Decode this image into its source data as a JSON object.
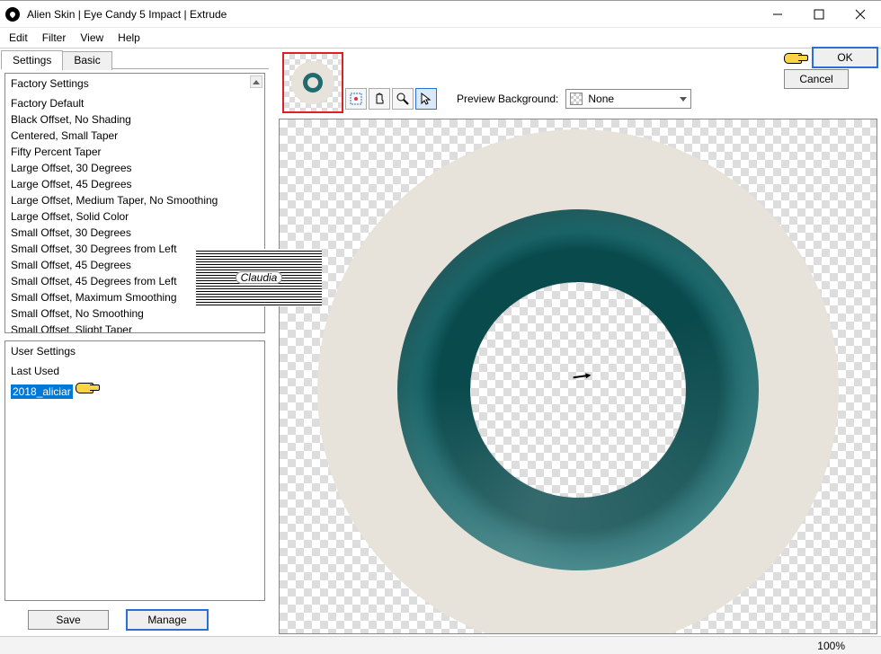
{
  "window": {
    "title": "Alien Skin | Eye Candy 5 Impact | Extrude"
  },
  "menu": {
    "edit": "Edit",
    "filter": "Filter",
    "view": "View",
    "help": "Help"
  },
  "tabs": {
    "settings": "Settings",
    "basic": "Basic"
  },
  "factory": {
    "title": "Factory Settings",
    "items": [
      "Factory Default",
      "Black Offset, No Shading",
      "Centered, Small Taper",
      "Fifty Percent Taper",
      "Large Offset, 30 Degrees",
      "Large Offset, 45 Degrees",
      "Large Offset, Medium Taper, No Smoothing",
      "Large Offset, Solid Color",
      "Small Offset, 30 Degrees",
      "Small Offset, 30 Degrees from Left",
      "Small Offset, 45 Degrees",
      "Small Offset, 45 Degrees from Left",
      "Small Offset, Maximum Smoothing",
      "Small Offset, No Smoothing",
      "Small Offset, Slight Taper"
    ]
  },
  "user": {
    "title": "User Settings",
    "items": [
      "Last Used",
      "2018_aliciar"
    ],
    "selected": "2018_aliciar"
  },
  "buttons": {
    "save": "Save",
    "manage": "Manage",
    "ok": "OK",
    "cancel": "Cancel"
  },
  "preview": {
    "bg_label": "Preview Background:",
    "bg_value": "None"
  },
  "status": {
    "zoom": "100%"
  },
  "watermark": {
    "text": "Claudia"
  }
}
